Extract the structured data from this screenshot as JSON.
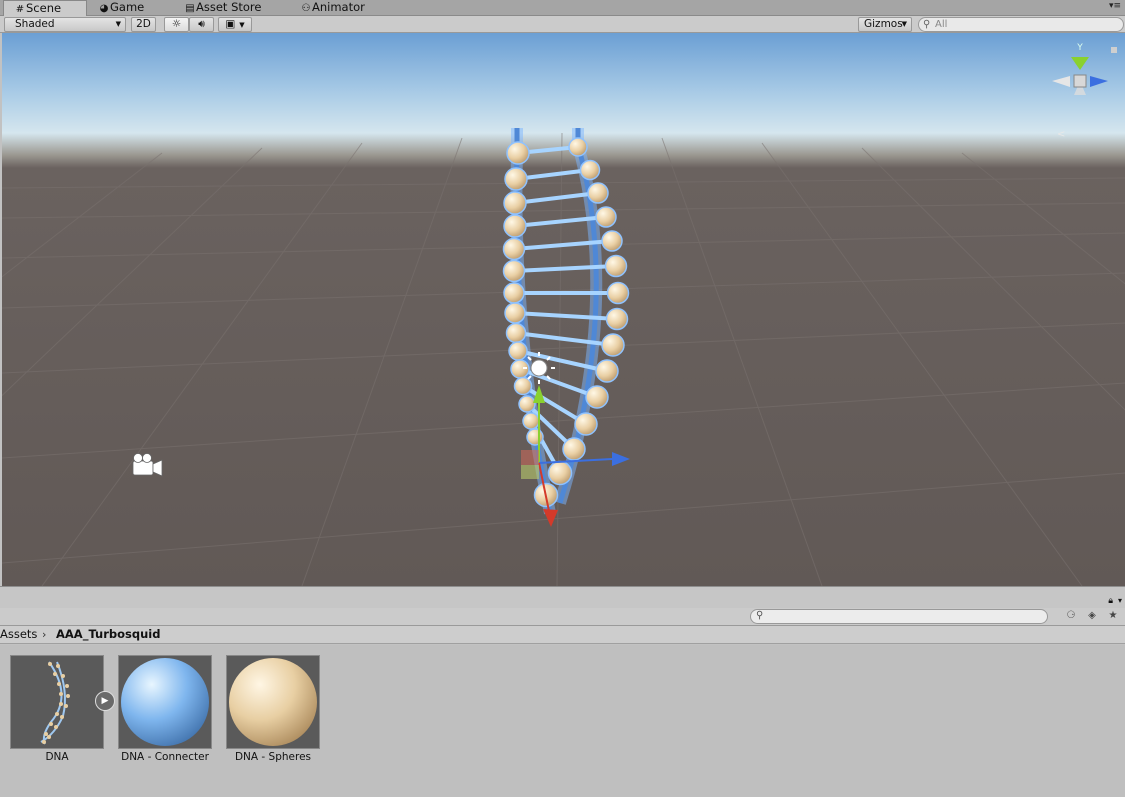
{
  "tabs": [
    {
      "label": "Scene",
      "icon": "hash-icon"
    },
    {
      "label": "Game",
      "icon": "pacman-icon"
    },
    {
      "label": "Asset Store",
      "icon": "store-icon"
    },
    {
      "label": "Animator",
      "icon": "animator-icon"
    }
  ],
  "toolbar": {
    "shading_mode": "Shaded",
    "btn_2d": "2D",
    "gizmos_label": "Gizmos",
    "search_placeholder": "All",
    "lighting_icon": "sun-icon",
    "audio_icon": "speaker-icon",
    "effects_icon": "image-icon"
  },
  "scene": {
    "sky_color": "#a9cbe6",
    "ground_color": "#645c59",
    "gizmo_axis_label": "Y",
    "axis_colors": {
      "x": "#d43a2a",
      "y": "#8ad12f",
      "z": "#3b6fe0"
    },
    "selection_outline": "#7cb6ff",
    "sphere_color": "#e9cfa4",
    "connector_color": "#9fd0ff"
  },
  "breadcrumbs": [
    "Assets",
    "AAA_Turbosquid"
  ],
  "assets": [
    {
      "label": "DNA",
      "kind": "prefab"
    },
    {
      "label": "DNA - Connecter",
      "kind": "material",
      "color": "#7fb6ee"
    },
    {
      "label": "DNA - Spheres",
      "kind": "material",
      "color": "#e8cfa3"
    }
  ]
}
